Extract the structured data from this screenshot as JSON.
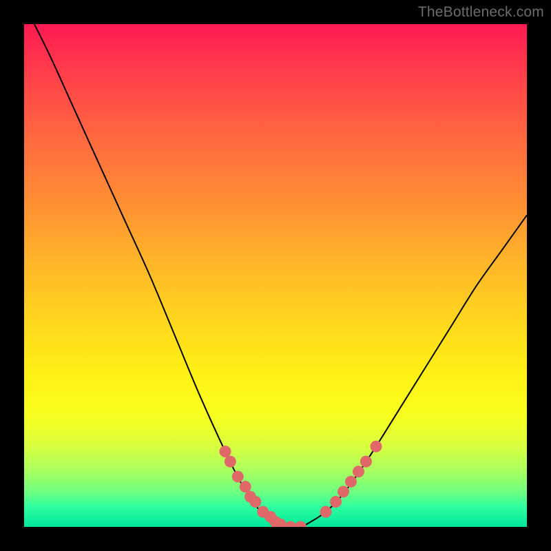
{
  "watermark": "TheBottleneck.com",
  "colors": {
    "frame": "#000000",
    "curve_stroke": "#000000",
    "dot_fill": "#e06868",
    "gradient_top": "#ff1a52",
    "gradient_bottom": "#00e59a"
  },
  "chart_data": {
    "type": "line",
    "title": "",
    "xlabel": "",
    "ylabel": "",
    "xlim": [
      0,
      100
    ],
    "ylim": [
      0,
      100
    ],
    "x": [
      0,
      5,
      10,
      15,
      20,
      25,
      30,
      35,
      40,
      43,
      45,
      47,
      49,
      51,
      53,
      55,
      57,
      60,
      63,
      66,
      70,
      75,
      80,
      85,
      90,
      95,
      100
    ],
    "values": [
      104,
      94,
      83,
      72,
      61,
      50,
      38,
      26,
      15,
      9,
      6,
      3,
      1,
      0,
      0,
      0,
      1,
      3,
      6,
      10,
      16,
      24,
      32,
      40,
      48,
      55,
      62
    ],
    "dots_x": [
      40,
      41,
      42.5,
      44,
      45,
      46,
      47.5,
      49,
      50,
      51,
      53,
      55,
      60,
      62,
      63.5,
      65,
      66.5,
      68,
      70
    ],
    "dots_y": [
      15,
      13,
      10,
      8,
      6,
      5,
      3,
      2,
      1,
      0.5,
      0,
      0,
      3,
      5,
      7,
      9,
      11,
      13,
      16
    ]
  }
}
